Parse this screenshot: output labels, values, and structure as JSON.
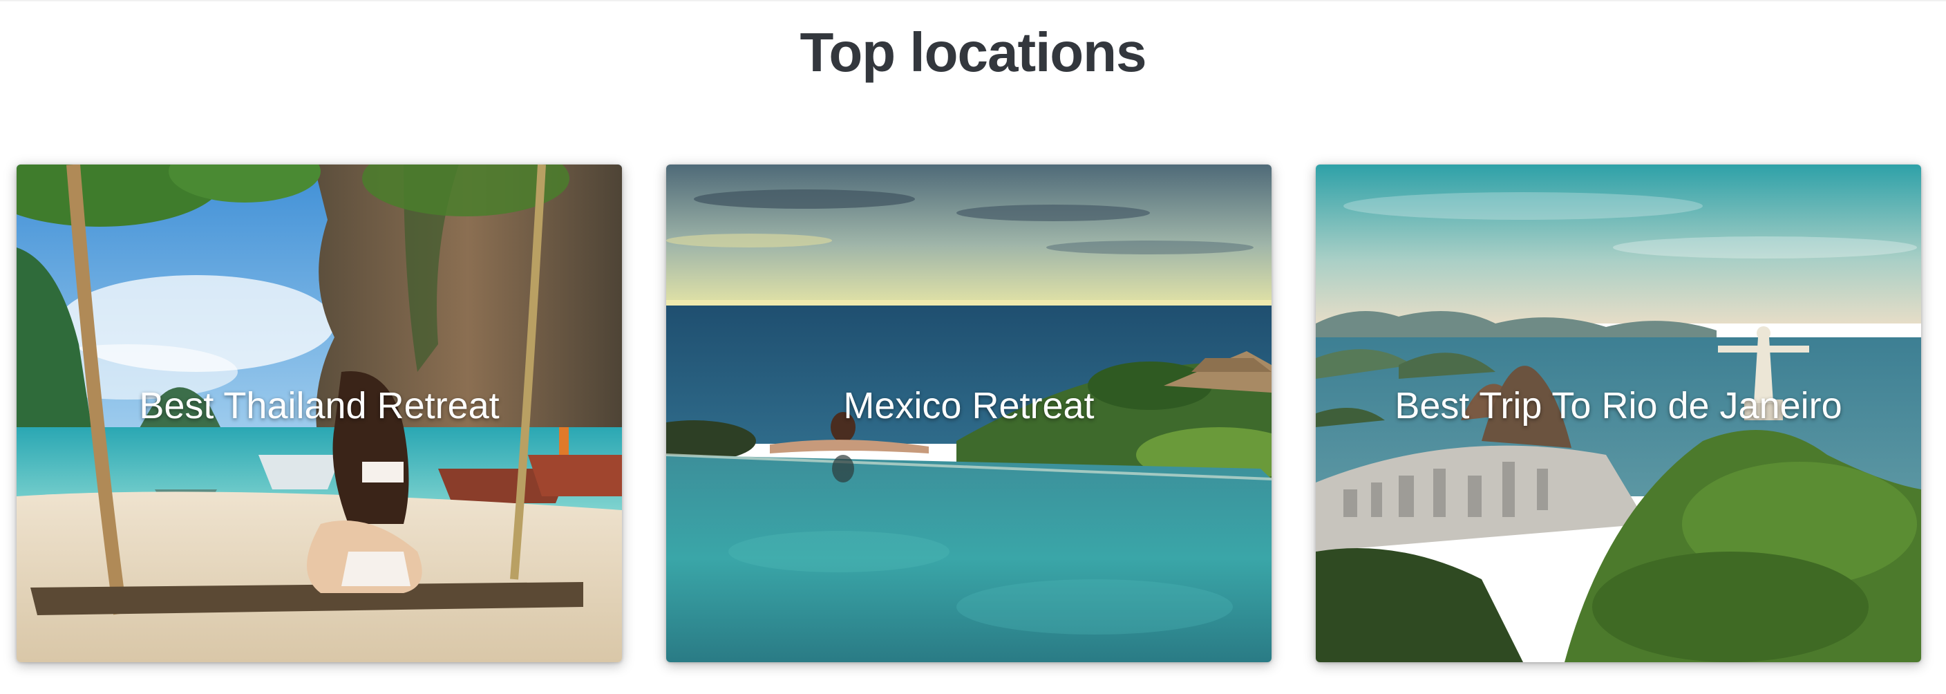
{
  "section": {
    "title": "Top locations"
  },
  "cards": [
    {
      "title": "Best Thailand Retreat",
      "image": "thailand-beach-swing-photo"
    },
    {
      "title": "Mexico Retreat",
      "image": "infinity-pool-ocean-photo"
    },
    {
      "title": "Best Trip To Rio de Janeiro",
      "image": "rio-christ-redeemer-photo"
    }
  ],
  "colors": {
    "title_text": "#33373d",
    "card_title_text": "#ffffff"
  }
}
